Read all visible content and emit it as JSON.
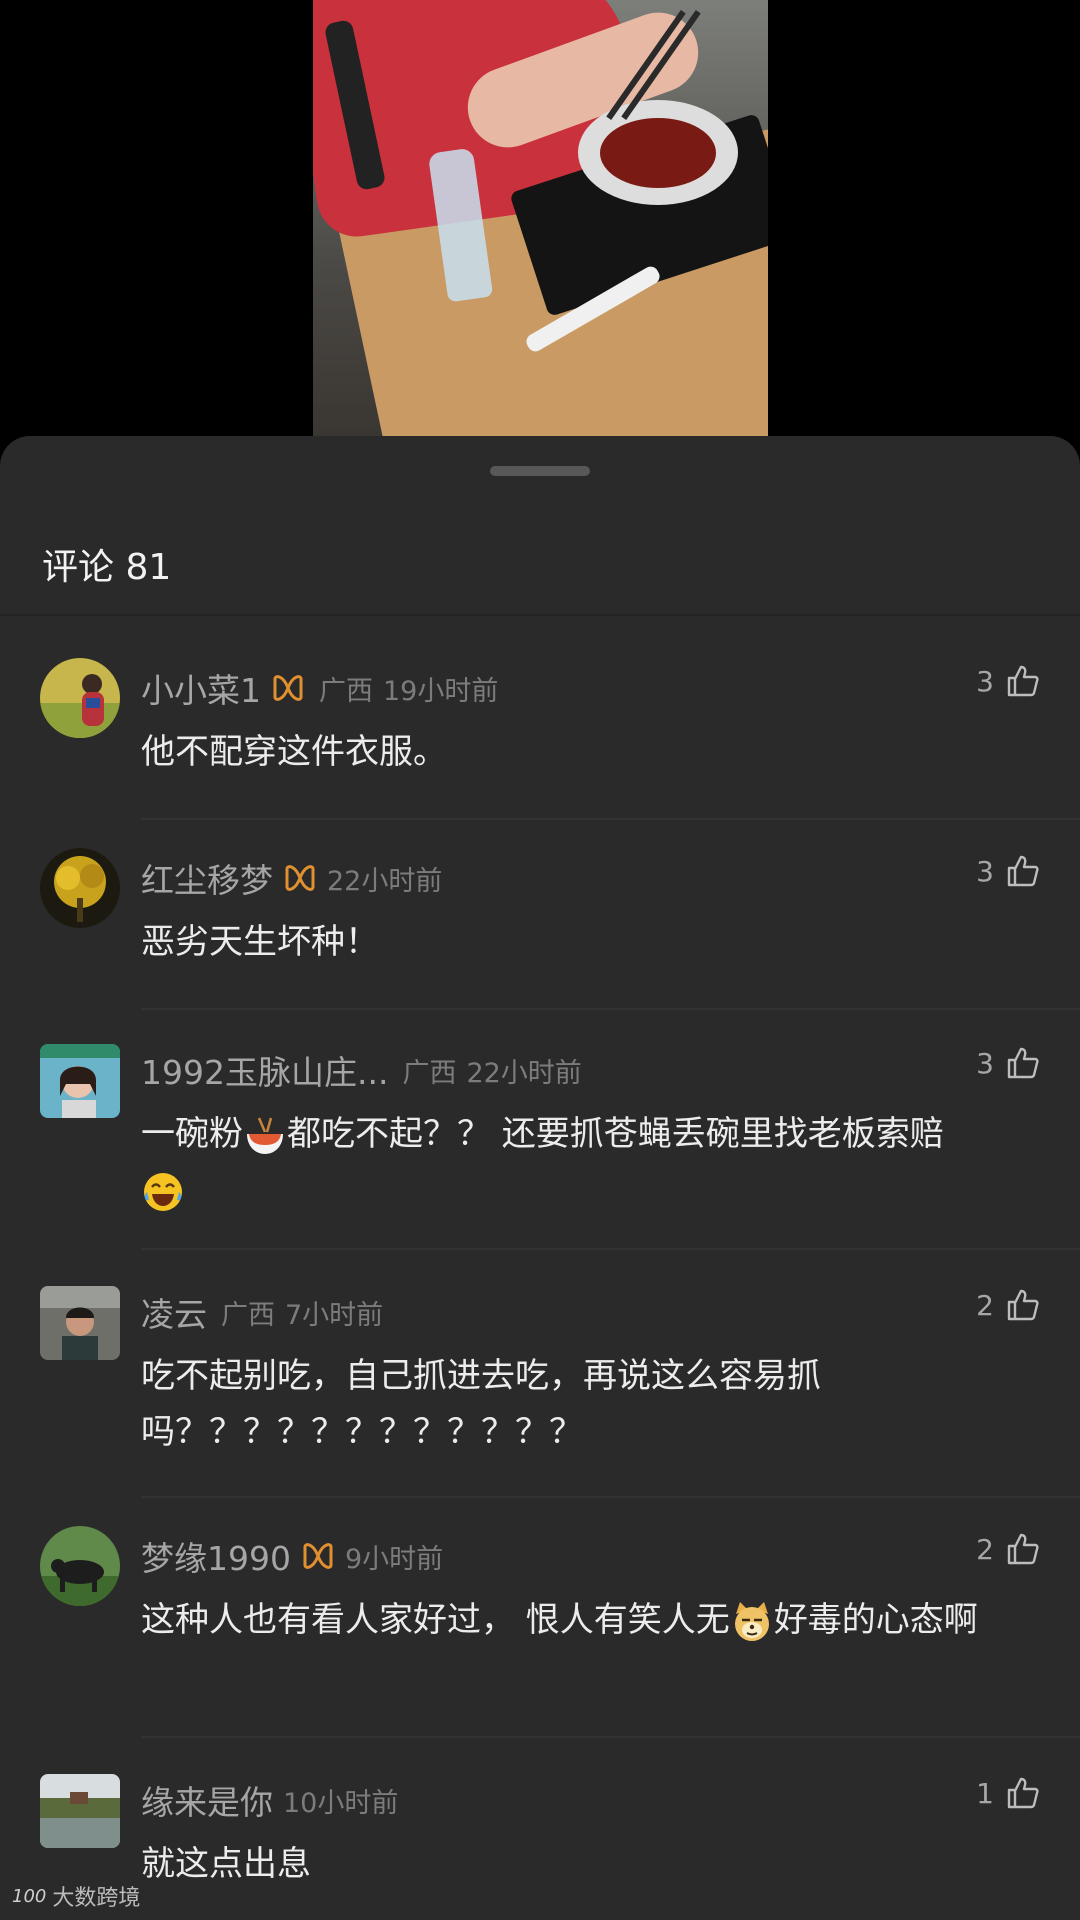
{
  "sheet": {
    "title": "评论 81"
  },
  "comments": [
    {
      "username": "小小菜1",
      "has_badge": true,
      "region": "广西",
      "time": "19小时前",
      "text": "他不配穿这件衣服。",
      "likes": "3",
      "avatar_icon": "woman-field-avatar"
    },
    {
      "username": "红尘移梦",
      "has_badge": true,
      "region": "",
      "time": "22小时前",
      "text": "恶劣天生坏种！",
      "likes": "3",
      "avatar_icon": "golden-tree-avatar"
    },
    {
      "username": "1992玉脉山庄...",
      "has_badge": false,
      "region": "广西",
      "time": "22小时前",
      "text_before_emoji": "一碗粉",
      "text_after_emoji": "都吃不起？？ 还要抓苍蝇丢碗里找老板索赔",
      "likes": "3",
      "avatar_icon": "woman-portrait-avatar",
      "emojis": [
        "noodle-bowl-emoji",
        "crying-laughing-emoji"
      ]
    },
    {
      "username": "凌云",
      "has_badge": false,
      "region": "广西",
      "time": "7小时前",
      "text": "吃不起别吃，自己抓进去吃，再说这么容易抓吗？？？？？？？？？？？？",
      "likes": "2",
      "avatar_icon": "man-car-avatar"
    },
    {
      "username": "梦缘1990",
      "has_badge": true,
      "region": "",
      "time": "9小时前",
      "text_before_emoji": "这种人也有看人家好过， 恨人有笑人无",
      "text_after_emoji": "好毒的心态啊",
      "likes": "2",
      "avatar_icon": "buffalo-avatar",
      "emojis": [
        "dog-face-emoji"
      ]
    },
    {
      "username": "缘来是你",
      "has_badge": false,
      "region": "",
      "time": "10小时前",
      "text": "就这点出息",
      "likes": "1",
      "avatar_icon": "landscape-avatar"
    }
  ],
  "watermark": {
    "logo": "100",
    "text": "大数跨境"
  },
  "icons": {
    "like": "thumbs-up-icon",
    "badge": "infinity-badge-icon",
    "accent": "#e0902e"
  }
}
